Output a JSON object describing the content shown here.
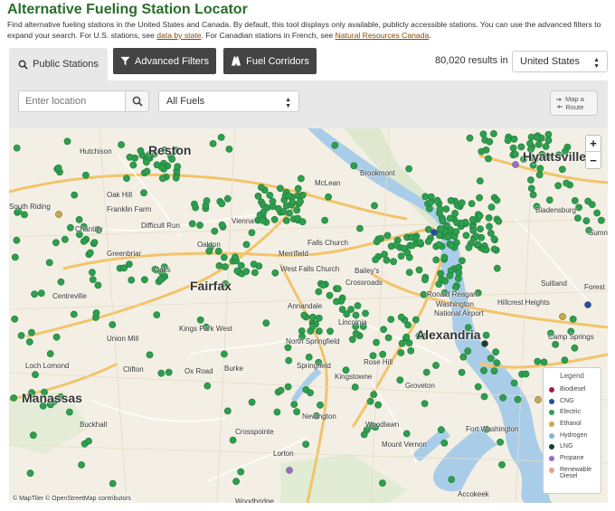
{
  "header": {
    "title": "Alternative Fueling Station Locator",
    "intro_text": "Find alternative fueling stations in the United States and Canada. By default, this tool displays only available, publicly accessible stations. You can use the advanced filters to expand your search. For U.S. stations, see ",
    "link_state": "data by state",
    "intro_mid": ". For Canadian stations in French, see ",
    "link_canada": "Natural Resources Canada",
    "intro_end": "."
  },
  "tabs": {
    "public": "Public Stations",
    "advanced": "Advanced Filters",
    "corridors": "Fuel Corridors"
  },
  "results": {
    "count": "80,020 results in",
    "country": "United States"
  },
  "filters": {
    "location_placeholder": "Enter location",
    "fuel_selected": "All Fuels",
    "map_route_line1": "Map a",
    "map_route_line2": "Route"
  },
  "map": {
    "zoom_in": "+",
    "zoom_out": "−",
    "attribution": "© MapTiler © OpenStreetMap contributors",
    "places": [
      {
        "name": "Reston",
        "big": true
      },
      {
        "name": "Hyattsville",
        "big": true
      },
      {
        "name": "Hutchison"
      },
      {
        "name": "Oak Hill"
      },
      {
        "name": "Franklin Farm"
      },
      {
        "name": "Difficult Run"
      },
      {
        "name": "Vienna"
      },
      {
        "name": "Oakton"
      },
      {
        "name": "McLean"
      },
      {
        "name": "Brookmont"
      },
      {
        "name": "Falls Church"
      },
      {
        "name": "Chantilly"
      },
      {
        "name": "Greenbriar"
      },
      {
        "name": "Oaks"
      },
      {
        "name": "Centreville"
      },
      {
        "name": "Fairfax",
        "big": true
      },
      {
        "name": "Bailey's"
      },
      {
        "name": "Crossroads"
      },
      {
        "name": "Annandale"
      },
      {
        "name": "Lincolnia"
      },
      {
        "name": "Kings Park West"
      },
      {
        "name": "Union Mill"
      },
      {
        "name": "North Springfield"
      },
      {
        "name": "Alexandria",
        "big": true
      },
      {
        "name": "Loch Lomond"
      },
      {
        "name": "Clifton"
      },
      {
        "name": "Burke"
      },
      {
        "name": "Springfield"
      },
      {
        "name": "Kingstowne"
      },
      {
        "name": "Rose Hill"
      },
      {
        "name": "Groveton"
      },
      {
        "name": "Manassas",
        "big": true
      },
      {
        "name": "Newington"
      },
      {
        "name": "Buckhall"
      },
      {
        "name": "Crosspointe"
      },
      {
        "name": "Woodlawn"
      },
      {
        "name": "Fort Washington"
      },
      {
        "name": "Mount Vernon"
      },
      {
        "name": "Lorton"
      },
      {
        "name": "Hillcrest Heights"
      },
      {
        "name": "Suitland"
      },
      {
        "name": "Camp Springs"
      },
      {
        "name": "Forest"
      },
      {
        "name": "Accokeek"
      },
      {
        "name": "Woodbridge"
      },
      {
        "name": "Ronald Reagan"
      },
      {
        "name": "Washington"
      },
      {
        "name": "National Airport"
      },
      {
        "name": "Bladensburg"
      },
      {
        "name": "Sumner"
      },
      {
        "name": "South Riding"
      },
      {
        "name": "Merrifield"
      },
      {
        "name": "West Falls Church"
      },
      {
        "name": "Ox Road"
      }
    ]
  },
  "legend": {
    "title": "Legend",
    "items": [
      {
        "label": "Biodiesel",
        "color": "#a31d45"
      },
      {
        "label": "CNG",
        "color": "#1f4fa3"
      },
      {
        "label": "Electric",
        "color": "#2e9e4f"
      },
      {
        "label": "Ethanol",
        "color": "#c8a94a"
      },
      {
        "label": "Hydrogen",
        "color": "#7ab8d9"
      },
      {
        "label": "LNG",
        "color": "#1b3d2a"
      },
      {
        "label": "Propane",
        "color": "#9b6ec8"
      },
      {
        "label": "Renewable Diesel",
        "color": "#e6a08a"
      }
    ]
  }
}
